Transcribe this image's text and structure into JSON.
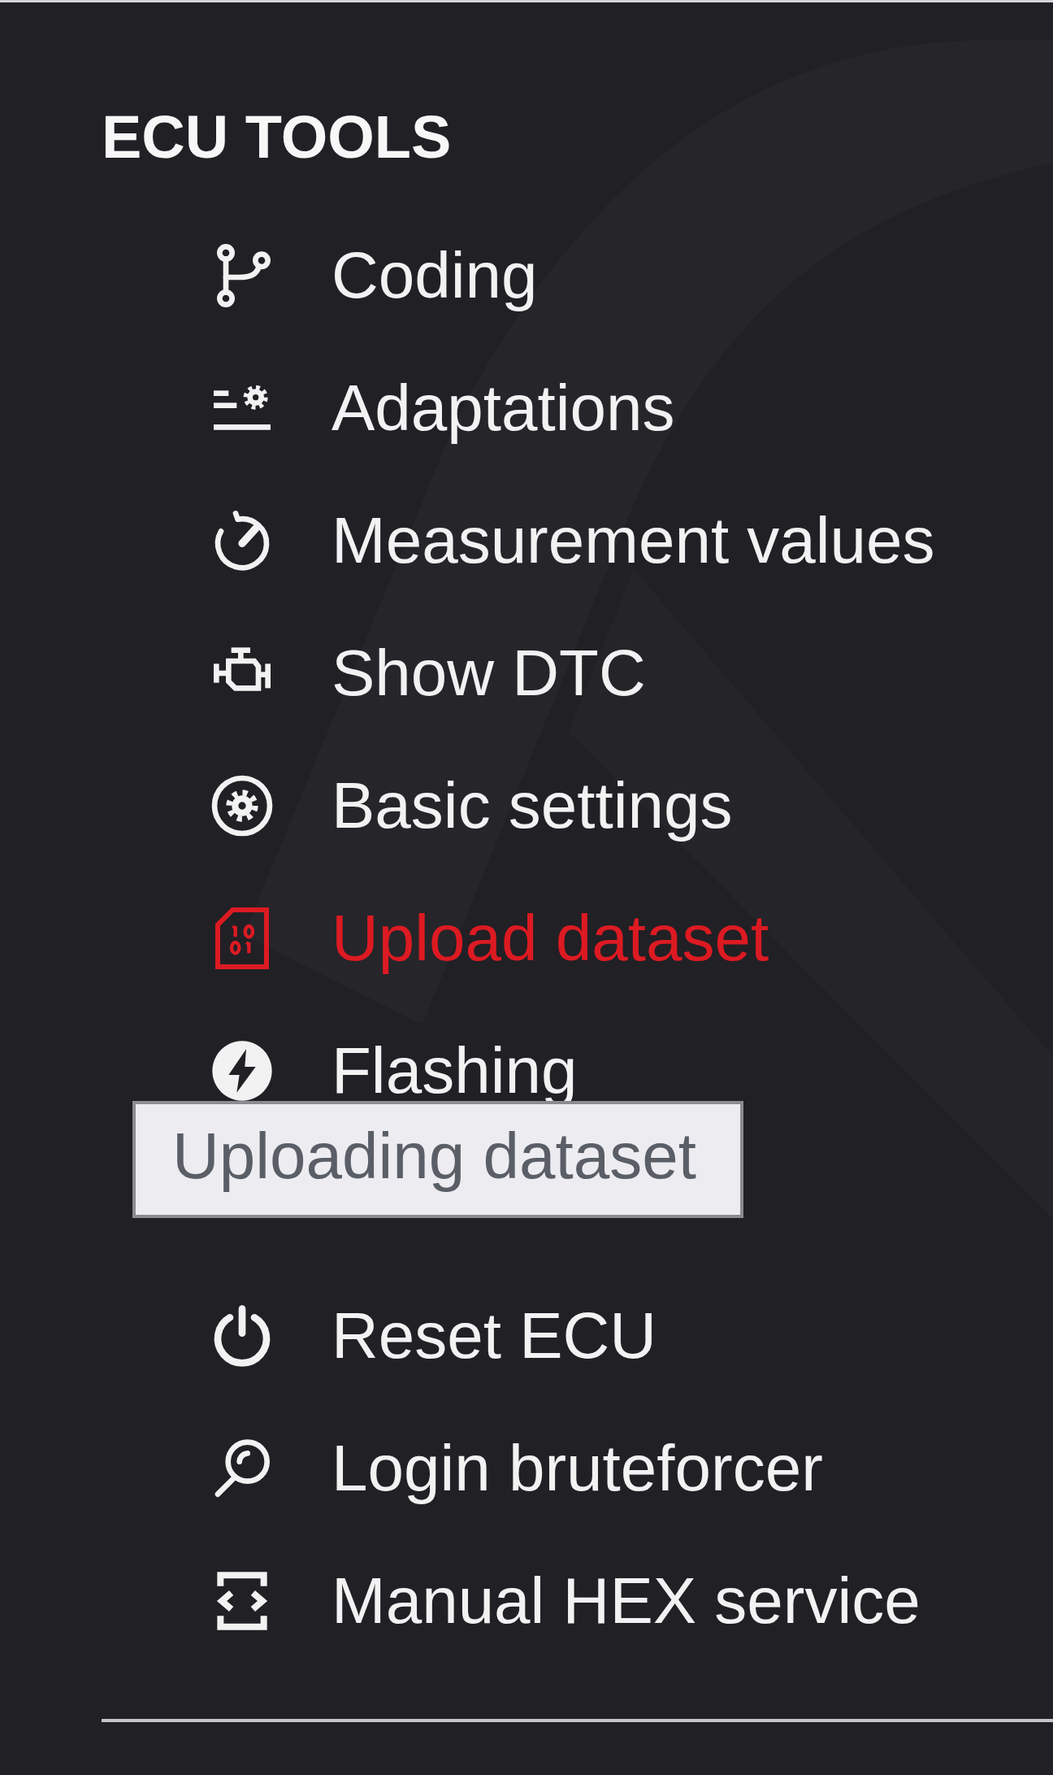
{
  "panel": {
    "title": "ECU TOOLS",
    "items": [
      {
        "label": "Coding",
        "kind": "coding",
        "selected": false
      },
      {
        "label": "Adaptations",
        "kind": "adaptations",
        "selected": false
      },
      {
        "label": "Measurement values",
        "kind": "measurements",
        "selected": false
      },
      {
        "label": "Show DTC",
        "kind": "dtc",
        "selected": false
      },
      {
        "label": "Basic settings",
        "kind": "basic",
        "selected": false
      },
      {
        "label": "Upload dataset",
        "kind": "upload",
        "selected": true
      },
      {
        "label": "Flashing",
        "kind": "flashing",
        "selected": false
      },
      {
        "label": "Reset ECU",
        "kind": "reset",
        "selected": false
      },
      {
        "label": "Login bruteforcer",
        "kind": "login",
        "selected": false
      },
      {
        "label": "Manual HEX service",
        "kind": "hex",
        "selected": false
      }
    ],
    "tooltip": {
      "text": "Uploading dataset"
    }
  }
}
